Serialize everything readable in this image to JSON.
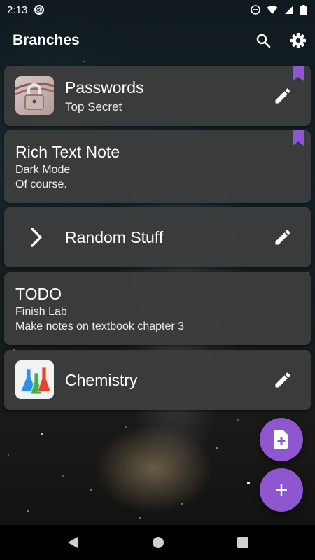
{
  "status": {
    "time": "2:13"
  },
  "app_bar": {
    "title": "Branches"
  },
  "cards": [
    {
      "type": "branch",
      "title": "Passwords",
      "subtitle": "Top Secret",
      "bookmarked": true
    },
    {
      "type": "note",
      "title": "Rich Text Note",
      "lines": [
        "Dark Mode",
        "Of course."
      ],
      "bookmarked": true
    },
    {
      "type": "branch",
      "title": "Random Stuff"
    },
    {
      "type": "note",
      "title": "TODO",
      "lines": [
        "Finish Lab",
        "Make notes on textbook chapter 3"
      ]
    },
    {
      "type": "branch",
      "title": "Chemistry"
    }
  ],
  "colors": {
    "accent": "#8e57cf",
    "card": "#3e3e3e"
  },
  "icons": [
    "search-icon",
    "gear-icon",
    "pencil-icon",
    "bookmark-icon",
    "chevron-right-icon",
    "note-add-icon",
    "plus-icon"
  ]
}
